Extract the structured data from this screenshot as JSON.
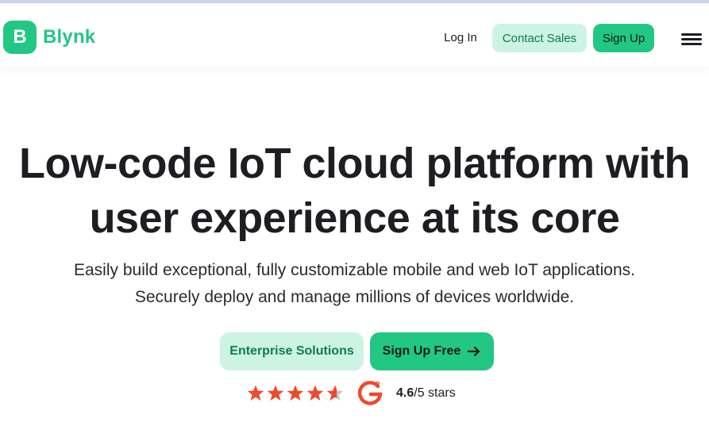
{
  "brand": {
    "name": "Blynk",
    "mark": "B",
    "color": "#22c784"
  },
  "nav": {
    "login": "Log In",
    "contact_sales": "Contact Sales",
    "sign_up": "Sign Up",
    "menu_icon": "hamburger-menu-icon"
  },
  "hero": {
    "title_line1": "Low-code IoT cloud platform with",
    "title_line2": "user experience at its core",
    "subtitle_line1": "Easily build exceptional, fully customizable mobile and web IoT applications.",
    "subtitle_line2": "Securely deploy and manage millions of devices worldwide."
  },
  "cta": {
    "enterprise": "Enterprise Solutions",
    "signup_free": "Sign Up Free",
    "arrow_icon": "arrow-right-icon"
  },
  "rating": {
    "score": "4.6",
    "suffix": "/5 stars",
    "value": 4.6,
    "max": 5,
    "star_color": "#f0492b",
    "badge_icon": "g2-logo-icon"
  },
  "colors": {
    "accent": "#22c784",
    "accent_light": "#ccf3e3",
    "accent_text": "#0c7d4f",
    "text": "#1d1d22"
  }
}
